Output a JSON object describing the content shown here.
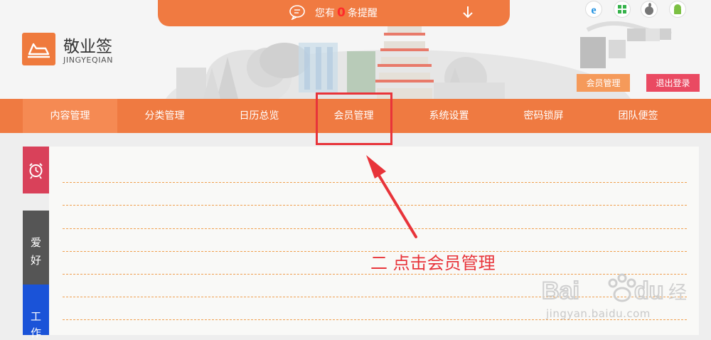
{
  "notification": {
    "prefix": "您有",
    "count": "0",
    "suffix": "条提醒"
  },
  "platform_icons": [
    "ie-icon",
    "windows-icon",
    "apple-icon",
    "android-icon"
  ],
  "logo": {
    "title": "敬业签",
    "subtitle": "JINGYEQIAN",
    "icon": "boat-icon"
  },
  "header_buttons": {
    "member": "会员管理",
    "logout": "退出登录"
  },
  "nav": {
    "items": [
      "内容管理",
      "分类管理",
      "日历总览",
      "会员管理",
      "系统设置",
      "密码锁屏",
      "团队便签"
    ],
    "active_index": 0
  },
  "side_tabs": {
    "reminder_icon": "alarm-clock-icon",
    "hobby": [
      "爱",
      "好"
    ],
    "work": [
      "工",
      "作"
    ]
  },
  "annotation": {
    "text": "二   点击会员管理"
  },
  "watermark": {
    "url": "jingyan.baidu.com"
  },
  "colors": {
    "accent": "#ef7a41",
    "active": "#f58a53",
    "logout": "#ea4a62",
    "annotation": "#e8343a"
  }
}
